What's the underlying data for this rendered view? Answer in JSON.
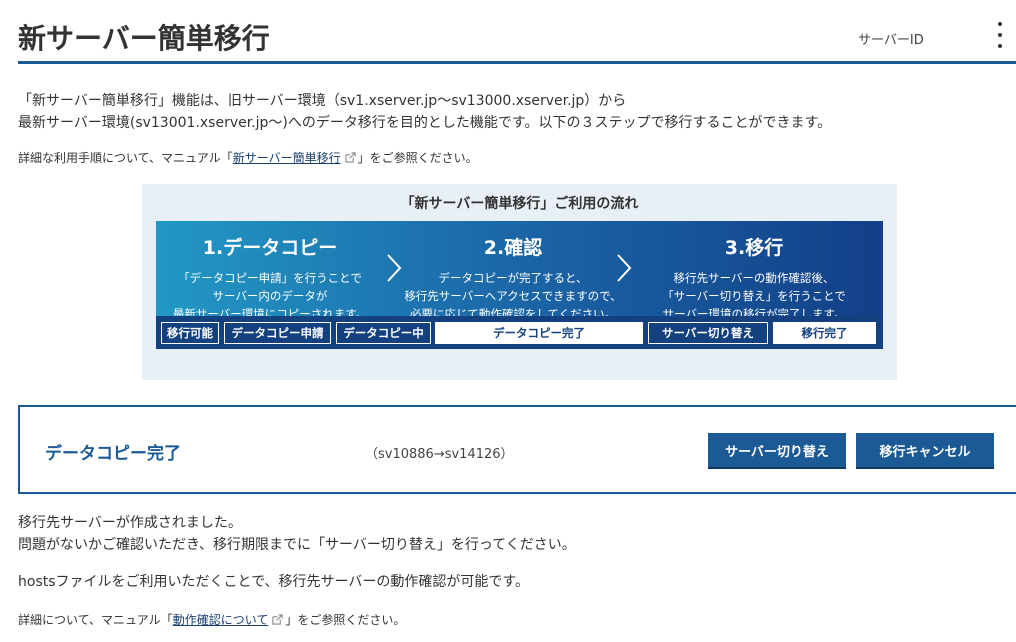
{
  "header": {
    "title": "新サーバー簡単移行",
    "server_id_label": "サーバーID"
  },
  "intro": {
    "line1": "「新サーバー簡単移行」機能は、旧サーバー環境（sv1.xserver.jp〜sv13000.xserver.jp）から",
    "line2": "最新サーバー環境(sv13001.xserver.jp〜)へのデータ移行を目的とした機能です。以下の３ステップで移行することができます。",
    "note_prefix": "詳細な利用手順について、マニュアル「",
    "note_link": "新サーバー簡単移行",
    "note_suffix": "」をご参照ください。"
  },
  "flow": {
    "title": "「新サーバー簡単移行」ご利用の流れ",
    "steps": [
      {
        "head": "1.データコピー",
        "lines": [
          "「データコピー申請」を行うことで",
          "サーバー内のデータが",
          "最新サーバー環境にコピーされます。"
        ]
      },
      {
        "head": "2.確認",
        "lines": [
          "データコピーが完了すると、",
          "移行先サーバーへアクセスできますので、",
          "必要に応じて動作確認をしてください。"
        ]
      },
      {
        "head": "3.移行",
        "lines": [
          "移行先サーバーの動作確認後、",
          "「サーバー切り替え」を行うことで",
          "サーバー環境の移行が完了します。"
        ]
      }
    ],
    "statuses": [
      "移行可能",
      "データコピー申請",
      "データコピー中",
      "データコピー完了",
      "サーバー切り替え",
      "移行完了"
    ]
  },
  "status": {
    "title": "データコピー完了",
    "servers": "（sv10886→sv14126）",
    "switch_button": "サーバー切り替え",
    "cancel_button": "移行キャンセル"
  },
  "messages": {
    "line1": "移行先サーバーが作成されました。",
    "line2": "問題がないかご確認いただき、移行期限までに「サーバー切り替え」を行ってください。",
    "line3": "hostsファイルをご利用いただくことで、移行先サーバーの動作確認が可能です。",
    "detail_prefix": "詳細について、マニュアル「",
    "detail_link": "動作確認について",
    "detail_suffix": "」をご参照ください。"
  },
  "colors": {
    "brand_blue": "#1c5a96",
    "navy": "#13407f",
    "flow_bg": "#e8eff6"
  }
}
